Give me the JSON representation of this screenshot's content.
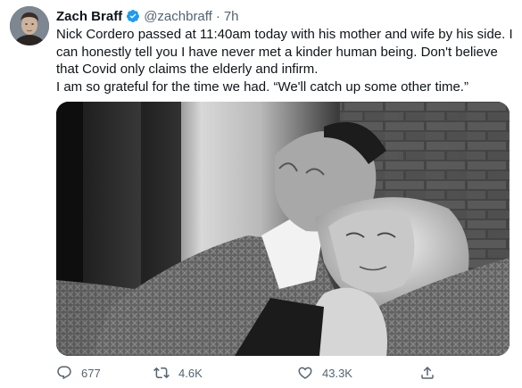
{
  "author": {
    "name": "Zach Braff",
    "handle": "@zachbraff",
    "separator": "·",
    "time": "7h",
    "verified": true,
    "verified_color": "#1d9bf0"
  },
  "tweet": {
    "lines": [
      "Nick Cordero passed at 11:40am today with his mother and wife by his side. I",
      "can honestly tell you I have never met a kinder human being. Don't believe",
      "that Covid only claims the elderly and infirm.",
      "I am so grateful for the time we had. “We'll catch up some other time.”"
    ]
  },
  "actions": {
    "reply_count": "677",
    "retweet_count": "4.6K",
    "like_count": "43.3K",
    "icons": [
      "reply-icon",
      "retweet-icon",
      "like-icon",
      "share-icon"
    ],
    "icon_color": "#536471"
  }
}
